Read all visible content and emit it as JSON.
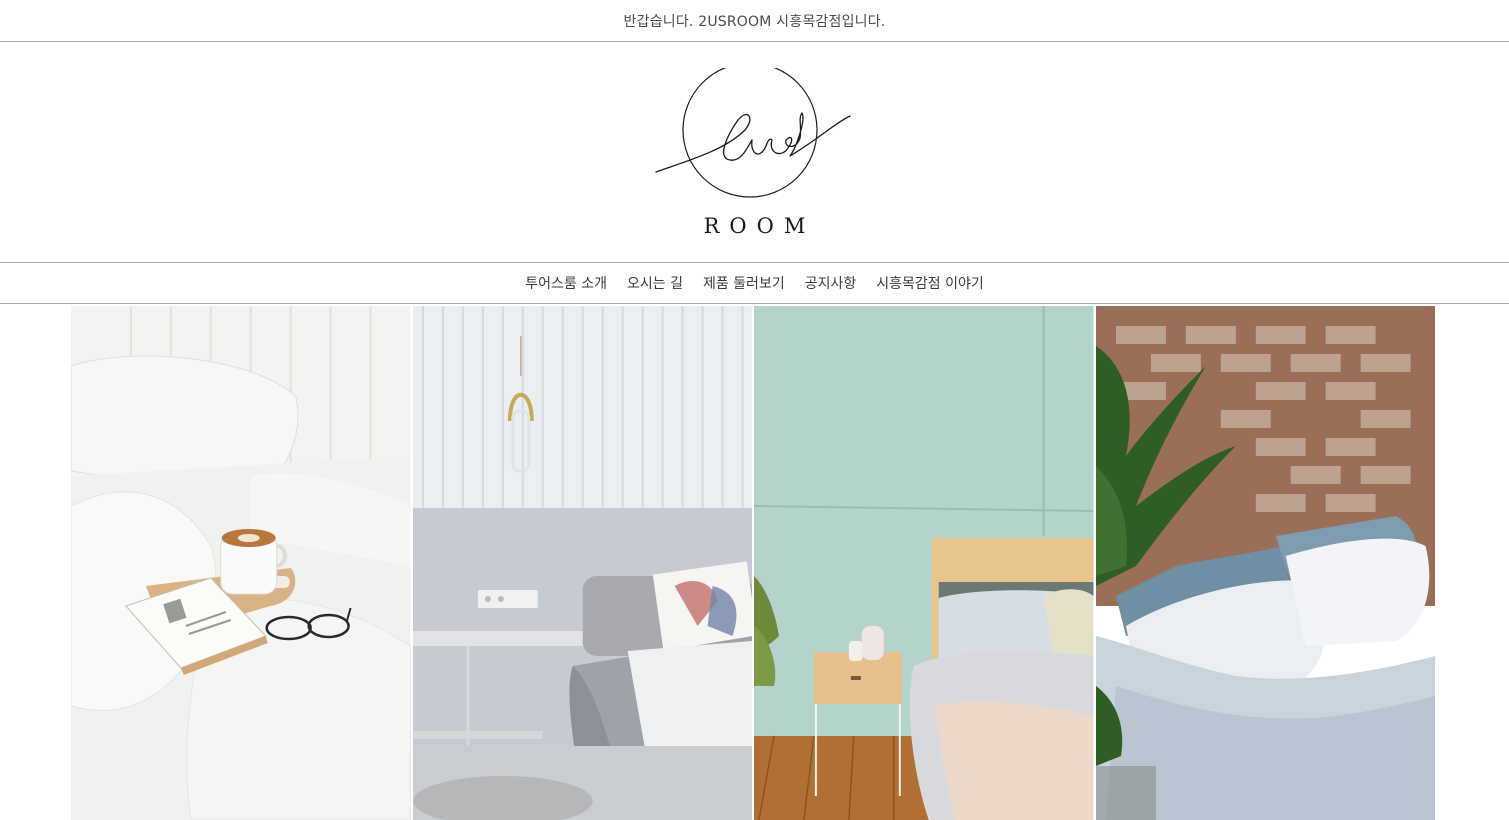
{
  "topbar": {
    "greeting": "반갑습니다. 2USROOM 시흥목감점입니다."
  },
  "logo": {
    "script_text": "2us",
    "wordmark": "ROOM"
  },
  "nav": {
    "items": [
      {
        "label": "투어스룸 소개"
      },
      {
        "label": "오시는 길"
      },
      {
        "label": "제품 둘러보기"
      },
      {
        "label": "공지사항"
      },
      {
        "label": "시흥목감점 이야기"
      }
    ]
  },
  "gallery": {
    "photos": [
      {
        "subject": "white-bedding-with-coffee-and-book"
      },
      {
        "subject": "grey-sofa-bed-with-pendant-light"
      },
      {
        "subject": "mint-wall-bedroom-with-nightstand"
      },
      {
        "subject": "brick-wall-bed-with-blue-pillows"
      }
    ]
  },
  "colors": {
    "border": "#a9a9a9",
    "text": "#444444"
  }
}
